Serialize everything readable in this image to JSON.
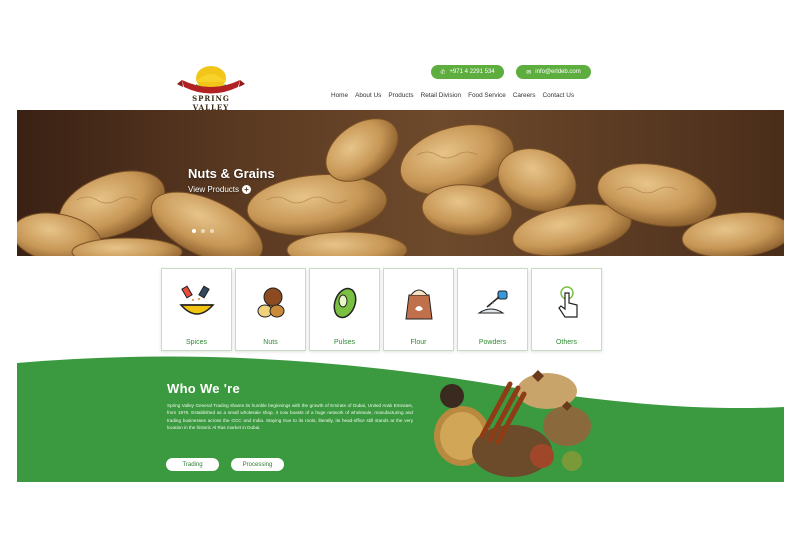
{
  "brand": {
    "name": "SPRING VALLEY"
  },
  "header": {
    "phone": "+971 4 2291 534",
    "email": "info@erldeb.com",
    "nav": [
      "Home",
      "About Us",
      "Products",
      "Retail Division",
      "Food Service",
      "Careers",
      "Contact Us"
    ]
  },
  "hero": {
    "title": "Nuts & Grains",
    "link_label": "View Products",
    "slide_count": 3,
    "active_slide": 1
  },
  "categories": [
    {
      "label": "Spices",
      "icon": "spices-bowl-icon"
    },
    {
      "label": "Nuts",
      "icon": "nuts-icon"
    },
    {
      "label": "Pulses",
      "icon": "pulses-icon"
    },
    {
      "label": "Flour",
      "icon": "flour-sack-icon"
    },
    {
      "label": "Powders",
      "icon": "powder-scoop-icon"
    },
    {
      "label": "Others",
      "icon": "hand-pointer-icon"
    }
  ],
  "about": {
    "title": "Who We 're",
    "text": "Spring Valley General Trading shares its humble beginnings with the growth of Emirate of Dubai, United Arab Emirates, from 1976. Established as a small wholesale shop, it now boasts of a huge network of wholesale, manufacturing and trading businesses across the GCC and India. Staying true to its roots, literally, its head-office still stands at the very location in the historic Al Ras market in Dubai.",
    "buttons": [
      "Trading",
      "Processing"
    ]
  },
  "colors": {
    "accent": "#5dad3f",
    "green_band": "#3b9a3f",
    "text_green": "#2f8a35"
  }
}
